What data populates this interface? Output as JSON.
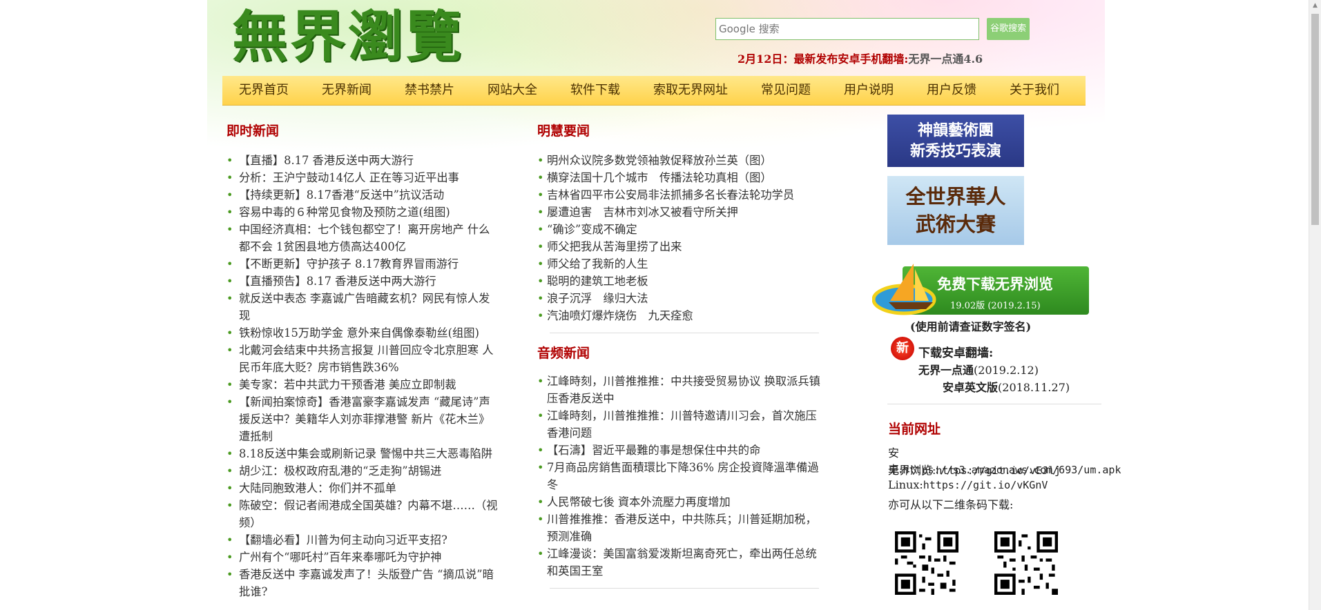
{
  "header": {
    "logo_text": "無界瀏覽",
    "search_placeholder": "Google 搜索",
    "search_button": "谷歌搜索",
    "announcement_main": "2月12日：最新发布安卓手机翻墙:",
    "announcement_tail": "无界一点通4.6"
  },
  "nav": {
    "items": [
      "无界首页",
      "无界新闻",
      "禁书禁片",
      "网站大全",
      "软件下载",
      "索取无界网址",
      "常见问题",
      "用户说明",
      "用户反馈",
      "关于我们"
    ]
  },
  "left_column": {
    "heading": "即时新闻",
    "items": [
      "【直播】8.17 香港反送中两大游行",
      "分析：王沪宁鼓动14亿人 正在等习近平出事",
      "【持续更新】8.17香港“反送中”抗议活动",
      "容易中毒的６种常见食物及预防之道(组图)",
      "中国经济真相：七个钱包都空了！离开房地产 什么都不会 1贫困县地方债高达400亿",
      "【不断更新】守护孩子 8.17教育界冒雨游行",
      "【直播预告】8.17 香港反送中两大游行",
      "就反送中表态 李嘉诚广告暗藏玄机？网民有惊人发现",
      "铁粉惊收15万助学金 意外来自偶像泰勒丝(组图)",
      "北戴河会结束中共扬言报复 川普回应令北京胆寒 人民币年底大贬？房市销售跌36%",
      "美专家：若中共武力干预香港 美应立即制裁",
      "【新闻拍案惊奇】香港富豪李嘉诚发声 “藏尾诗”声援反送中？美籍华人刘亦菲撑港警 新片《花木兰》遭抵制",
      "8.18反送中集会或刷新记录 警惕中共三大恶毒陷阱",
      "胡少江：极权政府乱港的“乏走狗”胡锡进",
      "大陆同胞致港人：你们并不孤单",
      "陈破空：假记者闹港成全国英雄？内幕不堪……（视频）",
      "【翻墙必看】川普为何主动向习近平支招?",
      "广州有个“哪吒村”百年来奉哪吒为守护神",
      "香港反送中 李嘉诚发声了！头版登广告 “摘瓜说”暗批谁?"
    ]
  },
  "middle_column": {
    "heading1": "明慧要闻",
    "items1": [
      "明州众议院多数党领袖敦促释放孙兰英（图）",
      "横穿法国十几个城市　传播法轮功真相（图）",
      "吉林省四平市公安局非法抓捕多名长春法轮功学员",
      "屡遭迫害　吉林市刘冰又被看守所关押",
      "“确诊”变成不确定",
      "师父把我从苦海里捞了出来",
      "师父给了我新的人生",
      "聪明的建筑工地老板",
      "浪子沉浮　缘归大法",
      "汽油喷灯爆炸烧伤　九天痊愈"
    ],
    "heading2": "音频新闻",
    "items2": [
      "江峰時刻，川普推推推：中共接受贸易协议 换取派兵镇压香港反送中",
      "江峰時刻，川普推推推：川普特邀请川习会，首次施压香港问题",
      "【石濤】習近平最難的事是想保住中共的命",
      "7月商品房銷售面積環比下降36% 房企投資降溫準備過冬",
      "人民幣破七後 資本外流壓力再度增加",
      "川普推推推：香港反送中，中共陈兵；川普延期加税，预测准确",
      "江峰漫谈：美国富翁爱泼斯坦离奇死亡，牵出两任总统和英国王室"
    ]
  },
  "right_column": {
    "banner1_line1": "神韻藝術團",
    "banner1_line2": "新秀技巧表演",
    "banner2_line1": "全世界華人",
    "banner2_line2": "武術大賽",
    "download_title": "免费下载无界浏览",
    "download_version": "19.02版 (2019.2.15)",
    "download_note": "(使用前请查证数字签名)",
    "new_badge": "新",
    "android_title": "下载安卓翻墙:",
    "android_link1_label": "无界一点通",
    "android_link1_date": "(2019.2.12)",
    "android_link2_label": "安卓英文版",
    "android_link2_date": "(2018.11.27)",
    "current_url_heading": "当前网址",
    "url_android_label": "安卓:",
    "url_android": "https://s3.amazonaws.com/693/um.apk",
    "url_browser_label": "无界浏览:",
    "url_browser": "https://git.io/vEJlj",
    "url_linux_label": "Linux:",
    "url_linux": "https://git.io/vKGnV",
    "qr_note": "亦可从以下二维条码下载:"
  }
}
